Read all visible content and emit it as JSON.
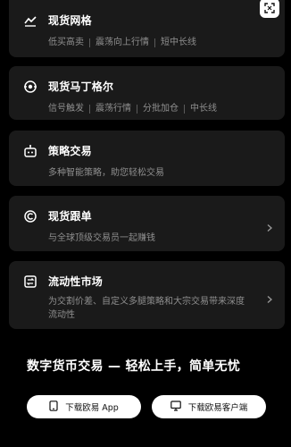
{
  "cards": [
    {
      "title": "现货网格",
      "icon": "grid-chart-icon",
      "tags": [
        "低买高卖",
        "震荡向上行情",
        "短中长线"
      ],
      "has_chevron": false
    },
    {
      "title": "现货马丁格尔",
      "icon": "martingale-icon",
      "tags": [
        "信号触发",
        "震荡行情",
        "分批加仓",
        "中长线"
      ],
      "has_chevron": false
    },
    {
      "title": "策略交易",
      "icon": "robot-icon",
      "description": "多种智能策略，助您轻松交易",
      "has_chevron": false
    },
    {
      "title": "现货跟单",
      "icon": "copy-trade-icon",
      "description": "与全球顶级交易员一起赚钱",
      "has_chevron": true
    },
    {
      "title": "流动性市场",
      "icon": "liquidity-icon",
      "description": "为交割价差、自定义多腿策略和大宗交易带来深度流动性",
      "has_chevron": true
    }
  ],
  "tagline": "数字货币交易 — 轻松上手，简单无忧",
  "buttons": {
    "app": {
      "label": "下载欧易 App",
      "icon": "phone-icon"
    },
    "client": {
      "label": "下载欧易客户端",
      "icon": "monitor-icon"
    }
  },
  "expand_icon": "expand-icon"
}
